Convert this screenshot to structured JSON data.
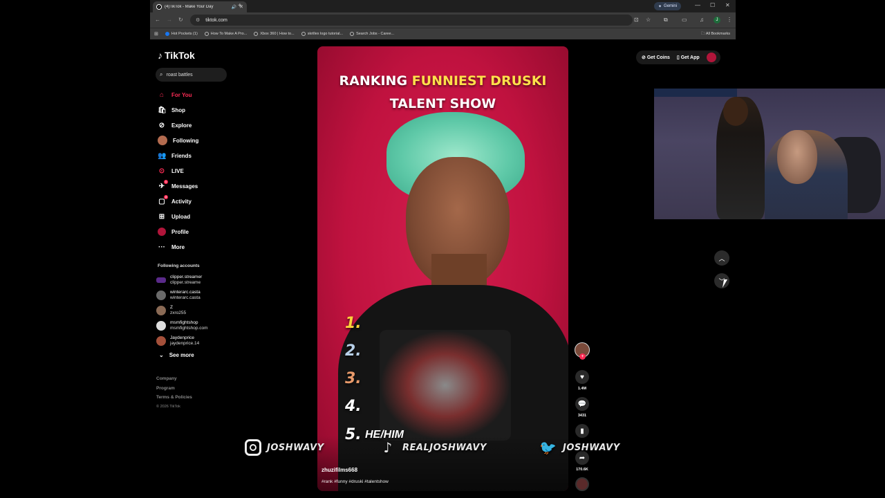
{
  "browser": {
    "tab_title": "(4)TikTok - Make Your Day",
    "url": "tiktok.com",
    "gemini_label": "Gemini",
    "bookmarks": [
      "Hot Pockets (1)",
      "How To Make A Pro...",
      "Xbox 360 | How to...",
      "skrillex logo tutorial...",
      "Search Jobs - Caree..."
    ],
    "all_bookmarks": "All Bookmarks",
    "profile_initial": "J"
  },
  "tiktok": {
    "logo": "TikTok",
    "search_value": "roast battles",
    "nav": [
      {
        "label": "For You",
        "icon": "home-icon"
      },
      {
        "label": "Shop",
        "icon": "shop-icon"
      },
      {
        "label": "Explore",
        "icon": "compass-icon"
      },
      {
        "label": "Following",
        "icon": "following-icon"
      },
      {
        "label": "Friends",
        "icon": "friends-icon"
      },
      {
        "label": "LIVE",
        "icon": "live-icon"
      },
      {
        "label": "Messages",
        "icon": "messages-icon",
        "badge": "1"
      },
      {
        "label": "Activity",
        "icon": "activity-icon",
        "badge": "3"
      },
      {
        "label": "Upload",
        "icon": "upload-icon"
      },
      {
        "label": "Profile",
        "icon": "profile-icon"
      },
      {
        "label": "More",
        "icon": "more-icon"
      }
    ],
    "following_title": "Following accounts",
    "following": [
      {
        "name": "clipper.streamer",
        "user": "clipper.streame"
      },
      {
        "name": "winterarc.casta",
        "user": "winterarc.casta"
      },
      {
        "name": "Z",
        "user": "zxro255"
      },
      {
        "name": "msmfightshop",
        "user": "msmfightshop.com"
      },
      {
        "name": "Jaydenprice",
        "user": "jaydenprice.14"
      }
    ],
    "see_more": "See more",
    "footer": [
      "Company",
      "Program",
      "Terms & Policies"
    ],
    "copyright": "© 2026 TikTok",
    "get_coins": "Get Coins",
    "get_app": "Get App"
  },
  "video": {
    "title_part1": "RANKING ",
    "title_highlight": "FUNNIEST DRUSKI",
    "title_line2": "TALENT SHOW",
    "ranks": [
      "1.",
      "2.",
      "3.",
      "4.",
      "5."
    ],
    "rank5_caption": "HE/HIM",
    "author": "zhuzifilms668",
    "hashtags": "#rank #funny #druski #talentshow",
    "likes": "1.4M",
    "comments": "3431",
    "shares": "170.6K",
    "colors": {
      "background": "#c0123f",
      "highlight": "#ffe04a",
      "accent": "#fe2c55"
    }
  },
  "overlay": {
    "instagram": "JOSHWAVY",
    "tiktok": "REALJOSHWAVY",
    "twitter": "JOSHWAVY"
  }
}
